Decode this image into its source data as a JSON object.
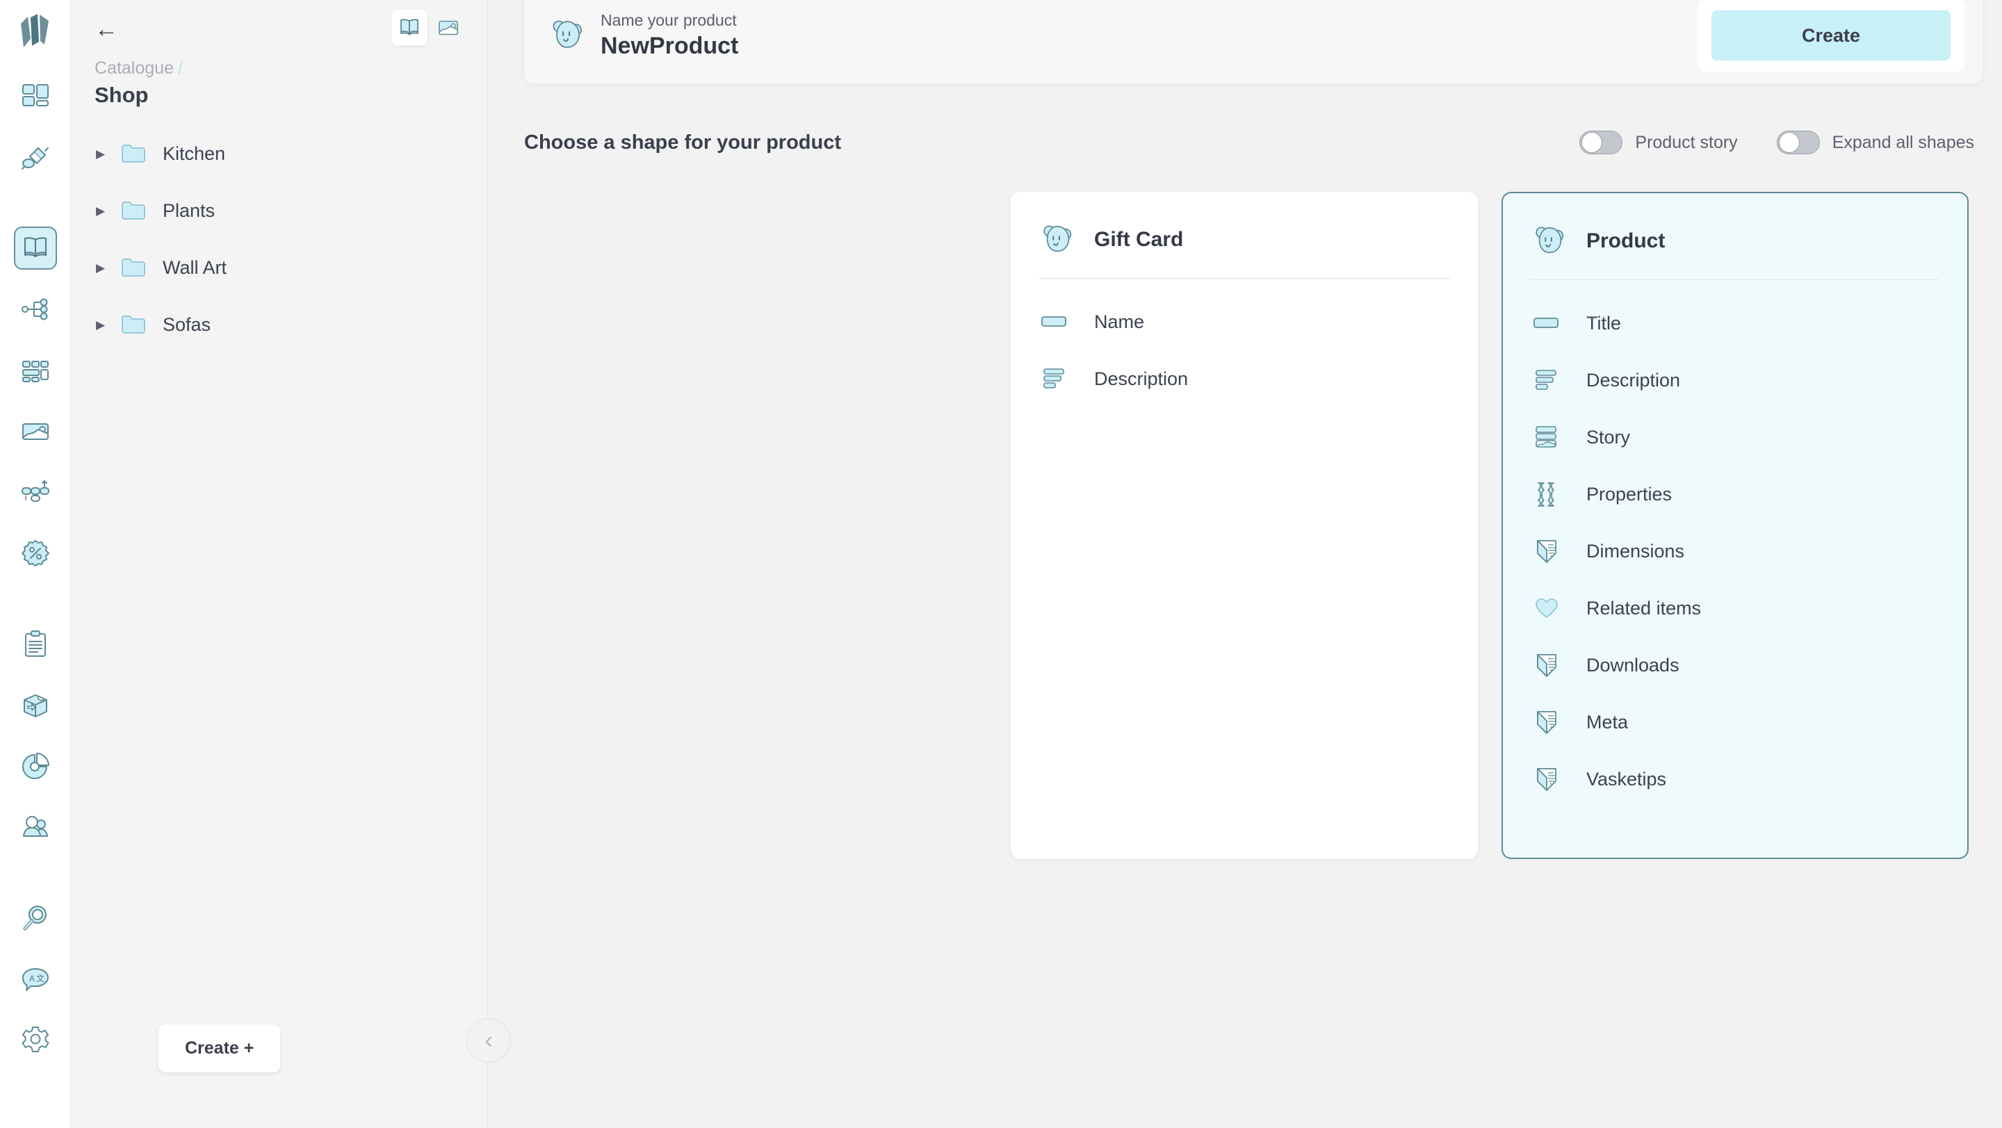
{
  "app": {
    "logo_icon": "pages-logo-icon"
  },
  "rail": {
    "items": [
      {
        "name": "dashboard-icon",
        "label": "Dashboard",
        "active": false
      },
      {
        "name": "plug-icon",
        "label": "Apps",
        "active": false
      },
      {
        "name": "book-icon",
        "label": "Catalogue",
        "active": true
      },
      {
        "name": "sitemap-icon",
        "label": "Structure",
        "active": false
      },
      {
        "name": "grid-blocks-icon",
        "label": "Blocks",
        "active": false
      },
      {
        "name": "image-icon",
        "label": "Media",
        "active": false
      },
      {
        "name": "shapes-icon",
        "label": "Shapes",
        "active": false
      },
      {
        "name": "discount-badge-icon",
        "label": "Discounts",
        "active": false
      },
      {
        "name": "clipboard-icon",
        "label": "Orders",
        "active": false
      },
      {
        "name": "box-shipping-icon",
        "label": "Shipping",
        "active": false
      },
      {
        "name": "pie-chart-icon",
        "label": "Analytics",
        "active": false
      },
      {
        "name": "users-icon",
        "label": "Customers",
        "active": false
      },
      {
        "name": "search-magnifier-icon",
        "label": "Search",
        "active": false
      },
      {
        "name": "translate-icon",
        "label": "Language",
        "active": false
      },
      {
        "name": "gear-icon",
        "label": "Settings",
        "active": false
      }
    ]
  },
  "tree_panel": {
    "back_arrow": "←",
    "view_toggle": [
      {
        "name": "book-view-icon",
        "selected": true
      },
      {
        "name": "image-view-icon",
        "selected": false
      }
    ],
    "breadcrumb": {
      "parent": "Catalogue",
      "separator": "/"
    },
    "title": "Shop",
    "caret": "▶",
    "folders": [
      {
        "label": "Kitchen"
      },
      {
        "label": "Plants"
      },
      {
        "label": "Wall Art"
      },
      {
        "label": "Sofas"
      }
    ],
    "create_button": "Create +",
    "collapse_icon": "‹"
  },
  "header": {
    "product_icon": "bear-face-icon",
    "kicker": "Name your product",
    "product_name": "NewProduct",
    "create_label": "Create",
    "create_color": "#c7f0f7"
  },
  "section": {
    "title": "Choose a shape for your product",
    "toggles": [
      {
        "label": "Product story",
        "on": false
      },
      {
        "label": "Expand all shapes",
        "on": false
      }
    ]
  },
  "shapes": [
    {
      "title": "Gift Card",
      "icon": "bear-face-icon",
      "selected": false,
      "fields": [
        {
          "label": "Name",
          "icon": "single-line-icon"
        },
        {
          "label": "Description",
          "icon": "paragraph-icon"
        }
      ]
    },
    {
      "title": "Product",
      "icon": "bear-face-icon",
      "selected": true,
      "fields": [
        {
          "label": "Title",
          "icon": "single-line-icon"
        },
        {
          "label": "Description",
          "icon": "paragraph-icon"
        },
        {
          "label": "Story",
          "icon": "content-chunk-icon"
        },
        {
          "label": "Properties",
          "icon": "properties-table-icon"
        },
        {
          "label": "Dimensions",
          "icon": "piece-shield-icon"
        },
        {
          "label": "Related items",
          "icon": "heart-icon"
        },
        {
          "label": "Downloads",
          "icon": "piece-shield-icon"
        },
        {
          "label": "Meta",
          "icon": "piece-shield-icon"
        },
        {
          "label": "Vasketips",
          "icon": "piece-shield-icon"
        }
      ]
    }
  ],
  "colors": {
    "accent": "#7fd4e3",
    "icon_fill": "#cdeef6",
    "icon_stroke": "#5d8a96",
    "selected_card_bg": "#effafd",
    "selected_card_border": "#5d8a96",
    "page_bg": "#f2f2f2",
    "text": "#3d4250"
  }
}
